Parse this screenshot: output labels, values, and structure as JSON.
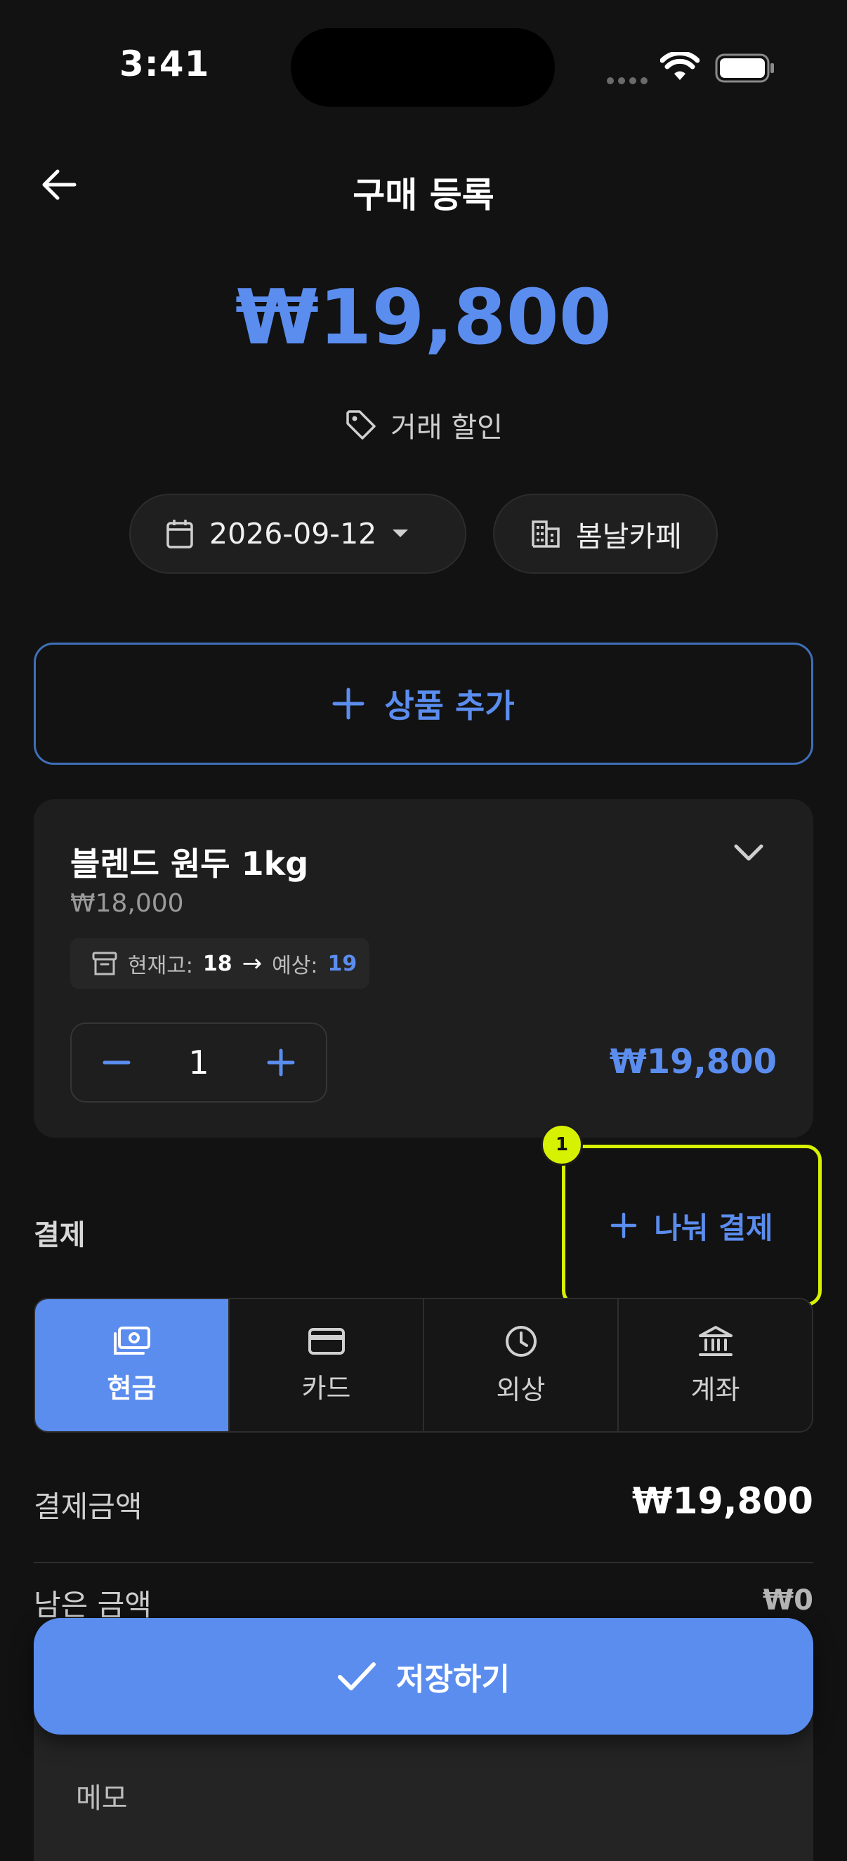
{
  "status_bar": {
    "time": "3:41"
  },
  "header": {
    "title": "구매 등록"
  },
  "summary": {
    "total": "₩19,800",
    "discount_label": "거래 할인"
  },
  "chips": {
    "date": "2026-09-12",
    "store": "봄날카페"
  },
  "add_product": {
    "label": "상품 추가"
  },
  "product": {
    "name": "블렌드 원두 1kg",
    "unit_price": "₩18,000",
    "stock_label": "현재고:",
    "stock_current": "18",
    "stock_arrow": "→",
    "stock_expected_label": "예상:",
    "stock_expected": "19",
    "quantity": "1",
    "line_total": "₩19,800"
  },
  "payment": {
    "label": "결제",
    "split_label": "나눠 결제",
    "badge": "1",
    "methods": [
      {
        "label": "현금",
        "icon": "cash-icon",
        "active": true
      },
      {
        "label": "카드",
        "icon": "card-icon",
        "active": false
      },
      {
        "label": "외상",
        "icon": "clock-icon",
        "active": false
      },
      {
        "label": "계좌",
        "icon": "bank-icon",
        "active": false
      }
    ],
    "paid_label": "결제금액",
    "paid_value": "₩19,800",
    "remaining_label": "남은 금액",
    "remaining_value": "₩0"
  },
  "memo": {
    "label": "메모"
  },
  "save": {
    "label": "저장하기"
  },
  "colors": {
    "accent": "#5b8def",
    "highlight": "#d7f200",
    "background": "#121212"
  }
}
